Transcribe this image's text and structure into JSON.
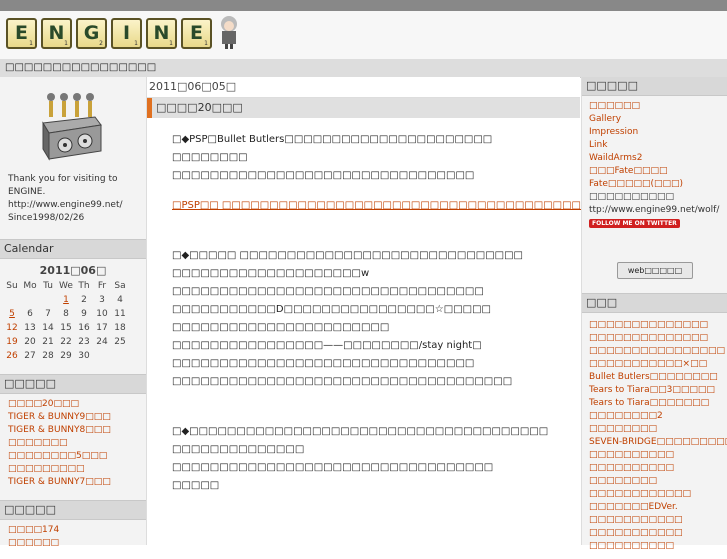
{
  "header": {
    "logo_letters": [
      {
        "letter": "E",
        "score": "1"
      },
      {
        "letter": "N",
        "score": "1"
      },
      {
        "letter": "G",
        "score": "2"
      },
      {
        "letter": "I",
        "score": "1"
      },
      {
        "letter": "N",
        "score": "1"
      },
      {
        "letter": "E",
        "score": "1"
      }
    ],
    "tagline": "□□□□□□□□□□□□□□□□"
  },
  "sidebar_left": {
    "about": {
      "line1": "Thank you for visiting to",
      "line2": "ENGINE.",
      "line3": "http://www.engine99.net/",
      "line4": "Since1998/02/26"
    },
    "calendar": {
      "title": "Calendar",
      "month": "2011□06□",
      "weekdays": [
        "Su",
        "Mo",
        "Tu",
        "We",
        "Th",
        "Fr",
        "Sa"
      ],
      "weeks": [
        [
          "",
          "",
          "",
          "1",
          "2",
          "3",
          "4"
        ],
        [
          "5",
          "6",
          "7",
          "8",
          "9",
          "10",
          "11"
        ],
        [
          "12",
          "13",
          "14",
          "15",
          "16",
          "17",
          "18"
        ],
        [
          "19",
          "20",
          "21",
          "22",
          "23",
          "24",
          "25"
        ],
        [
          "26",
          "27",
          "28",
          "29",
          "30",
          "",
          ""
        ]
      ]
    },
    "recent": {
      "title": "□□□□□",
      "items": [
        "□□□□20□□□",
        "TIGER & BUNNY9□□□",
        "TIGER & BUNNY8□□□",
        "□□□□□□□",
        "□□□□□□□□5□□□",
        "□□□□□□□□□",
        "TIGER & BUNNY7□□□"
      ]
    },
    "categories": {
      "title": "□□□□□",
      "items": [
        "□□□□174",
        "□□□□□□"
      ]
    }
  },
  "main": {
    "date": "2011□06□05□",
    "post_title": "□□□□20□□□",
    "para1": [
      "□◆PSP□Bullet Butlers□□□□□□□□□□□□□□□□□□□□□□",
      "□□□□□□□□",
      "□□□□□□□□□□□□□□□□□□□□□□□□□□□□□□□□"
    ],
    "link": "□PSP□□ □□□□□□□□□□□□□□□□□□□□□□□□□□□□□□□□□□□□□□□□□",
    "para2": [
      "□◆□□□□□ □□□□□□□□□□□□□□□□□□□□□□□□□□□□□□",
      "□□□□□□□□□□□□□□□□□□□□w",
      "□□□□□□□□□□□□□□□□□□□□□□□□□□□□□□□□□",
      "□□□□□□□□□□□D□□□□□□□□□□□□□□□□☆□□□□□",
      "□□□□□□□□□□□□□□□□□□□□□□□",
      "□□□□□□□□□□□□□□□□——□□□□□□□□/stay night□",
      "□□□□□□□□□□□□□□□□□□□□□□□□□□□□□□□□",
      "□□□□□□□□□□□□□□□□□□□□□□□□□□□□□□□□□□□□"
    ],
    "para3": [
      "□◆□□□□□□□□□□□□□□□□□□□□□□□□□□□□□□□□□□□□□□",
      "□□□□□□□□□□□□□□",
      "□□□□□□□□□□□□□□□□□□□□□□□□□□□□□□□□□□",
      "□□□□□"
    ]
  },
  "sidebar_right": {
    "links": {
      "title": "□□□□□",
      "items": [
        "□□□□□□",
        "Gallery",
        "Impression",
        "Link",
        "WaildArms2",
        "□□□Fate□□□□",
        "Fate□□□□□(□□□)"
      ],
      "profile": "□□□□□□□□□□",
      "url": "ttp://www.engine99.net/wolf/",
      "twitter": "FOLLOW ME ON TWITTER",
      "web_button": "web□□□□□"
    },
    "archive": {
      "title": "□□□",
      "items": [
        "□□□□□□□□□□□□□□",
        "□□□□□□□□□□□□□□",
        "□□□□□□□□□□□□□□□□",
        "□□□□□□□□□□□×□□",
        "Bullet Butlers□□□□□□□□",
        "Tears to Tiara□□3□□□□□",
        "Tears to Tiara□□□□□□□",
        "□□□□□□□□2",
        "□□□□□□□□",
        "SEVEN-BRIDGE□□□□□□□□□",
        "□□□□□□□□□□",
        "□□□□□□□□□□",
        "□□□□□□□□",
        "□□□□□□□□□□□□",
        "□□□□□□□EDVer.",
        "□□□□□□□□□□□",
        "□□□□□□□□□□□",
        "□□□□□□□□□□"
      ]
    }
  }
}
